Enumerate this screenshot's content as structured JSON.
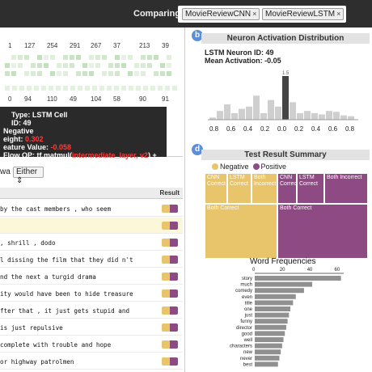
{
  "topbar": {
    "compare_label": "Comparing",
    "chips": [
      {
        "label": "MovieReviewCNN",
        "close": "×"
      },
      {
        "label": "MovieReviewLSTM",
        "close": "×"
      }
    ]
  },
  "neuron_grid": {
    "row1_numbers": [
      "1",
      "127",
      "254",
      "291",
      "267",
      "37",
      "213",
      "39"
    ],
    "row2_numbers": [
      "0",
      "94",
      "110",
      "49",
      "104",
      "58",
      "90",
      "91"
    ]
  },
  "tooltip": {
    "type": "Type: LSTM Cell",
    "id": "ID: 49",
    "label": "Negative",
    "weight_label": "eight:",
    "weight_value": "0.302",
    "feature_label": "eature Value:",
    "feature_value": "-0.058",
    "flow_label": "Flow OP: tf.matmul(",
    "flow_arg": "intermediate_layer, v2",
    "flow_rest": ") + b2"
  },
  "filter": {
    "prefix": "wa",
    "select_value": "Either"
  },
  "results": {
    "header": "Result",
    "rows": [
      {
        "text": "by the cast members , who seem",
        "hl": false
      },
      {
        "text": "",
        "hl": true
      },
      {
        "text": ", shrill , dodo",
        "hl": false
      },
      {
        "text": "l dissing the film that they did n't",
        "hl": false
      },
      {
        "text": "nd the next a turgid drama",
        "hl": false
      },
      {
        "text": "ity would have been to hide treasure",
        "hl": false
      },
      {
        "text": "fter that , it just gets stupid and",
        "hl": false
      },
      {
        "text": "is just repulsive",
        "hl": false
      },
      {
        "text": "complete with trouble and hope",
        "hl": false
      },
      {
        "text": "or highway patrolmen",
        "hl": false
      }
    ]
  },
  "activation": {
    "badge": "b",
    "title": "Neuron Activation Distribution",
    "neuron_id": "LSTM Neuron ID: 49",
    "mean": "Mean Activation: -0.05",
    "peak_label": "1.5",
    "x_ticks": [
      "0.8",
      "0.6",
      "0.4",
      "0.2",
      "0.0",
      "0.2",
      "0.4",
      "0.6",
      "0.8"
    ],
    "bars": [
      0.05,
      0.2,
      0.35,
      0.15,
      0.25,
      0.3,
      0.55,
      0.15,
      0.45,
      0.3,
      1.0,
      0.4,
      0.15,
      0.2,
      0.15,
      0.12,
      0.2,
      0.18,
      0.1,
      0.08
    ],
    "highlight_index": 10
  },
  "summary": {
    "badge": "d",
    "title": "Test Result Summary",
    "legend_negative": "Negative",
    "legend_positive": "Positive",
    "tm_labels": {
      "cnn_correct_a": "CNN Correct",
      "lstm_correct_a": "LSTM Correct",
      "both_incorrect_a": "Both Incorrect",
      "cnn_correct_b": "CNN Correct",
      "lstm_correct_b": "LSTM Correct",
      "both_incorrect_b": "Both Incorrect",
      "both_correct_a": "Both Correct",
      "both_correct_b": "Both Correct"
    },
    "word_freq_title": "Word Frequencies",
    "x_ticks": [
      "0",
      "20",
      "40",
      "60"
    ],
    "words": [
      "story",
      "much",
      "comedy",
      "even",
      "title",
      "one",
      "just",
      "funny",
      "director",
      "good",
      "well",
      "characters",
      "new",
      "never",
      "best"
    ],
    "counts": [
      63,
      42,
      36,
      30,
      28,
      26,
      25,
      24,
      23,
      22,
      21,
      20,
      19,
      18,
      17
    ],
    "colors": {
      "negative": "#e8c46a",
      "positive": "#8e4a82",
      "bar": "#909090",
      "accent": "#5b8fd9"
    }
  }
}
